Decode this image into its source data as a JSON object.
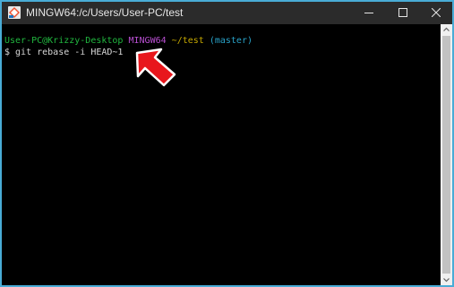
{
  "window": {
    "title": "MINGW64:/c/Users/User-PC/test",
    "border_color": "#49acd6",
    "titlebar_color": "#2b2b2b"
  },
  "terminal": {
    "prompt": {
      "user_host": "User-PC@Krizzy-Desktop",
      "system": "MINGW64",
      "path": "~/test",
      "branch": "(master)"
    },
    "command_line": "$ git rebase -i HEAD~1",
    "colors": {
      "user_host": "#21b73f",
      "system": "#b84fd1",
      "path": "#c5a800",
      "branch": "#29a2c8",
      "text": "#d6d6d6",
      "background": "#000000"
    }
  },
  "icons": {
    "app": "git-bash-icon",
    "minimize": "minimize-icon",
    "maximize": "maximize-icon",
    "close": "close-icon",
    "scroll_up": "chevron-up-icon",
    "scroll_down": "chevron-down-icon",
    "annotation": "red-arrow-pointer-icon"
  },
  "annotation_color": "#e8161c"
}
